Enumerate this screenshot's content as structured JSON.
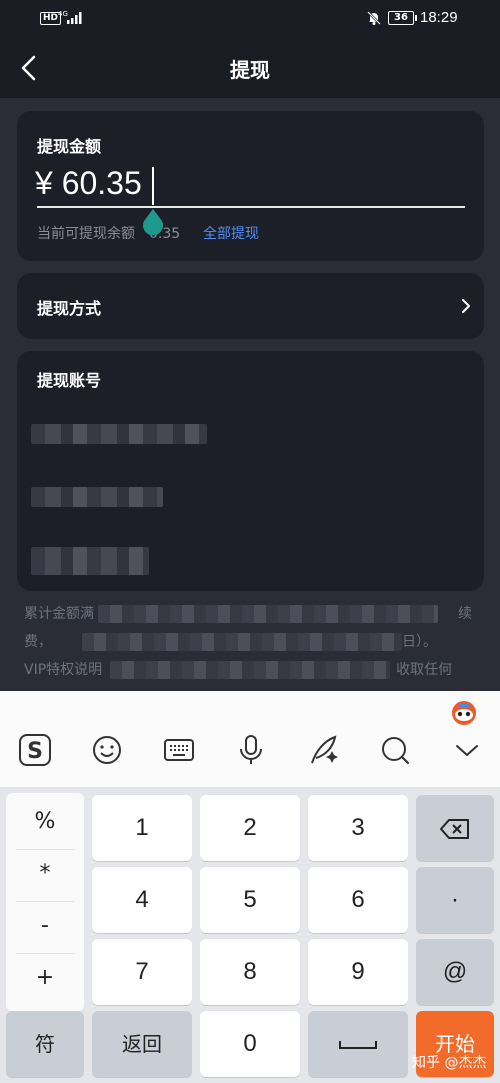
{
  "status_bar": {
    "hd": "HD",
    "network": "4G",
    "battery": "36",
    "time": "18:29"
  },
  "header": {
    "title": "提现"
  },
  "amount_card": {
    "label": "提现金额",
    "amount": "¥ 60.35",
    "available_text": "当前可提现余额",
    "available_value": "0.35",
    "withdraw_all": "全部提现"
  },
  "method_card": {
    "label": "提现方式"
  },
  "account_card": {
    "label": "提现账号"
  },
  "notes": {
    "line1_start": "累计金额满",
    "line1_end": "续",
    "line2_start": "费，",
    "line2_end": "日）。",
    "line3_start": "VIP特权说明",
    "line3_end": "收取任何"
  },
  "keyboard": {
    "symbols": [
      "%",
      "*",
      "-",
      "+"
    ],
    "digits": [
      "1",
      "2",
      "3",
      "4",
      "5",
      "6",
      "7",
      "8",
      "9",
      "0"
    ],
    "dot": "·",
    "at": "@",
    "fu": "符",
    "back": "返回",
    "start": "开始"
  },
  "watermark": "知乎 @杰杰",
  "colors": {
    "accent_blue": "#4f8ef7",
    "start_orange": "#f26b2b",
    "drop_teal": "#1e9a8c"
  }
}
